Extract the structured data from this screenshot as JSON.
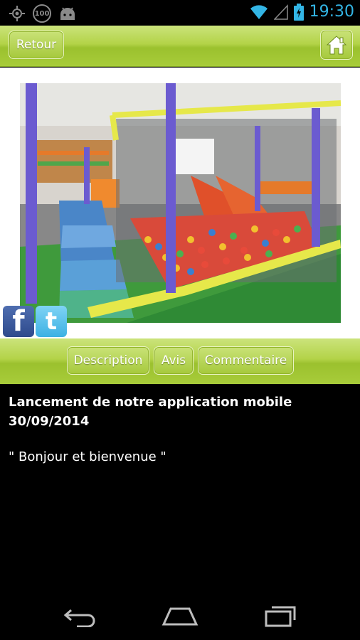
{
  "status_bar": {
    "time": "19:30",
    "left_icons": [
      "gps-icon",
      "speed-100-icon",
      "android-icon"
    ],
    "badge_text": "100",
    "right_icons": [
      "wifi-icon",
      "signal-icon",
      "battery-icon"
    ]
  },
  "header": {
    "back_label": "Retour",
    "home_icon": "home-icon"
  },
  "social": {
    "facebook_glyph": "f",
    "twitter_glyph": "t"
  },
  "tabs": [
    {
      "label": "Description"
    },
    {
      "label": "Avis"
    },
    {
      "label": "Commentaire"
    }
  ],
  "description": {
    "title": "Lancement de notre application mobile",
    "date": "30/09/2014",
    "quote": "\" Bonjour et bienvenue \""
  },
  "nav": {
    "icons": [
      "back-icon",
      "home-nav-icon",
      "recent-apps-icon"
    ]
  },
  "colors": {
    "accent_green": "#a8cc3a",
    "status_blue": "#33b5e5"
  }
}
